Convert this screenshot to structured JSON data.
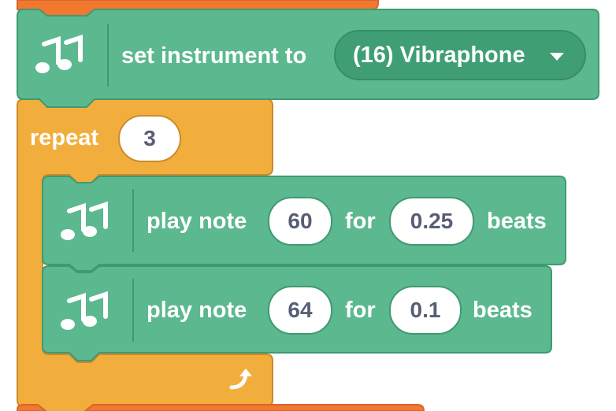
{
  "colors": {
    "music_block": "#5cb88f",
    "music_border": "#3f9a72",
    "control_block": "#f2ae3d",
    "control_border": "#cc8a2b",
    "event_block": "#f27830",
    "field_text": "#575e75"
  },
  "set_instrument_block": {
    "icon": "music-notes-icon",
    "label": "set instrument to",
    "dropdown_value": "(16) Vibraphone",
    "dropdown_icon": "caret-down-icon"
  },
  "repeat_block": {
    "label": "repeat",
    "count": "3",
    "loop_icon": "loop-arrow-icon"
  },
  "play_note_blocks": [
    {
      "icon": "music-notes-icon",
      "label": "play note",
      "note": "60",
      "for_label": "for",
      "beats": "0.25",
      "beats_label": "beats"
    },
    {
      "icon": "music-notes-icon",
      "label": "play note",
      "note": "64",
      "for_label": "for",
      "beats": "0.1",
      "beats_label": "beats"
    }
  ]
}
